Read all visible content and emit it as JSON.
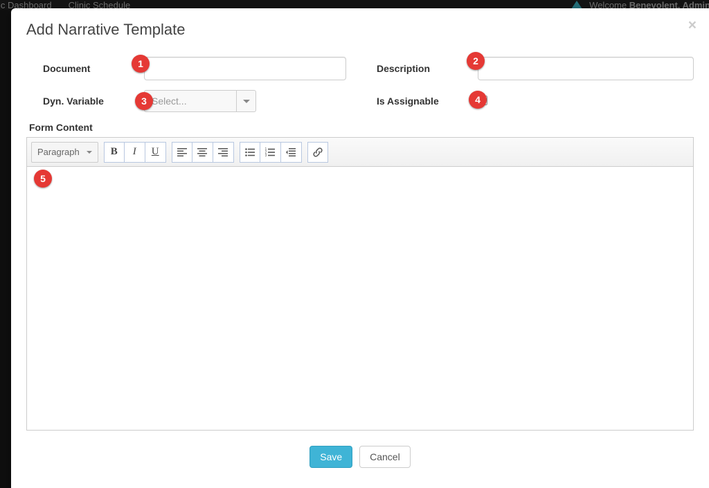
{
  "bg_nav": {
    "item1": "ic Dashboard",
    "item2": "Clinic Schedule",
    "welcome_prefix": "Welcome ",
    "welcome_user": "Benevolent, Admin"
  },
  "modal": {
    "title": "Add Narrative Template",
    "close_symbol": "×"
  },
  "fields": {
    "document_label": "Document",
    "document_value": "",
    "description_label": "Description",
    "description_value": "",
    "dynvar_label": "Dyn. Variable",
    "dynvar_placeholder": "Select...",
    "assignable_label": "Is Assignable",
    "assignable_checked": false,
    "form_content_label": "Form Content"
  },
  "toolbar": {
    "format_label": "Paragraph",
    "bold": "B",
    "italic": "I",
    "underline": "U"
  },
  "actions": {
    "save": "Save",
    "cancel": "Cancel"
  },
  "markers": {
    "m1": "1",
    "m2": "2",
    "m3": "3",
    "m4": "4",
    "m5": "5"
  }
}
